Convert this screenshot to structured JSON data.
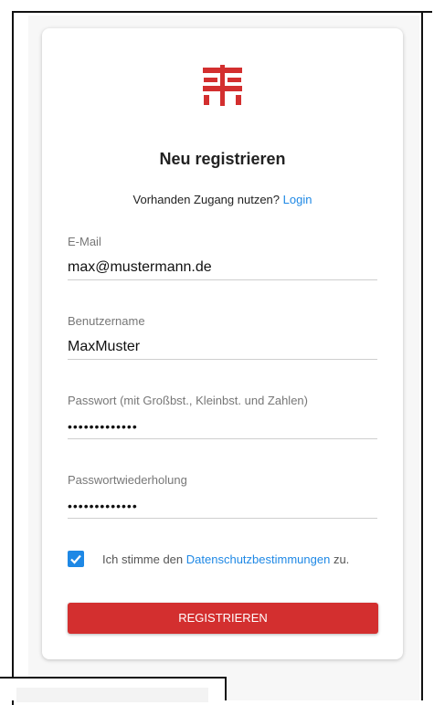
{
  "form": {
    "title": "Neu registrieren",
    "login_prompt": "Vorhanden Zugang nutzen?",
    "login_link": "Login",
    "email": {
      "label": "E-Mail",
      "value": "max@mustermann.de"
    },
    "username": {
      "label": "Benutzername",
      "value": "MaxMuster"
    },
    "password": {
      "label": "Passwort (mit Großbst., Kleinbst. und Zahlen)",
      "value": "•••••••••••••"
    },
    "password_repeat": {
      "label": "Passwortwiederholung",
      "value": "•••••••••••••"
    },
    "consent": {
      "checked": true,
      "text_before": "Ich stimme den",
      "link": "Datenschutzbestimmungen",
      "text_after": "zu."
    },
    "submit_label": "Registrieren"
  },
  "colors": {
    "brand_red": "#d32f2f",
    "accent_blue": "#1e88e5"
  },
  "icons": {
    "logo": "red-cross-brand-logo-icon",
    "check": "check-icon"
  }
}
